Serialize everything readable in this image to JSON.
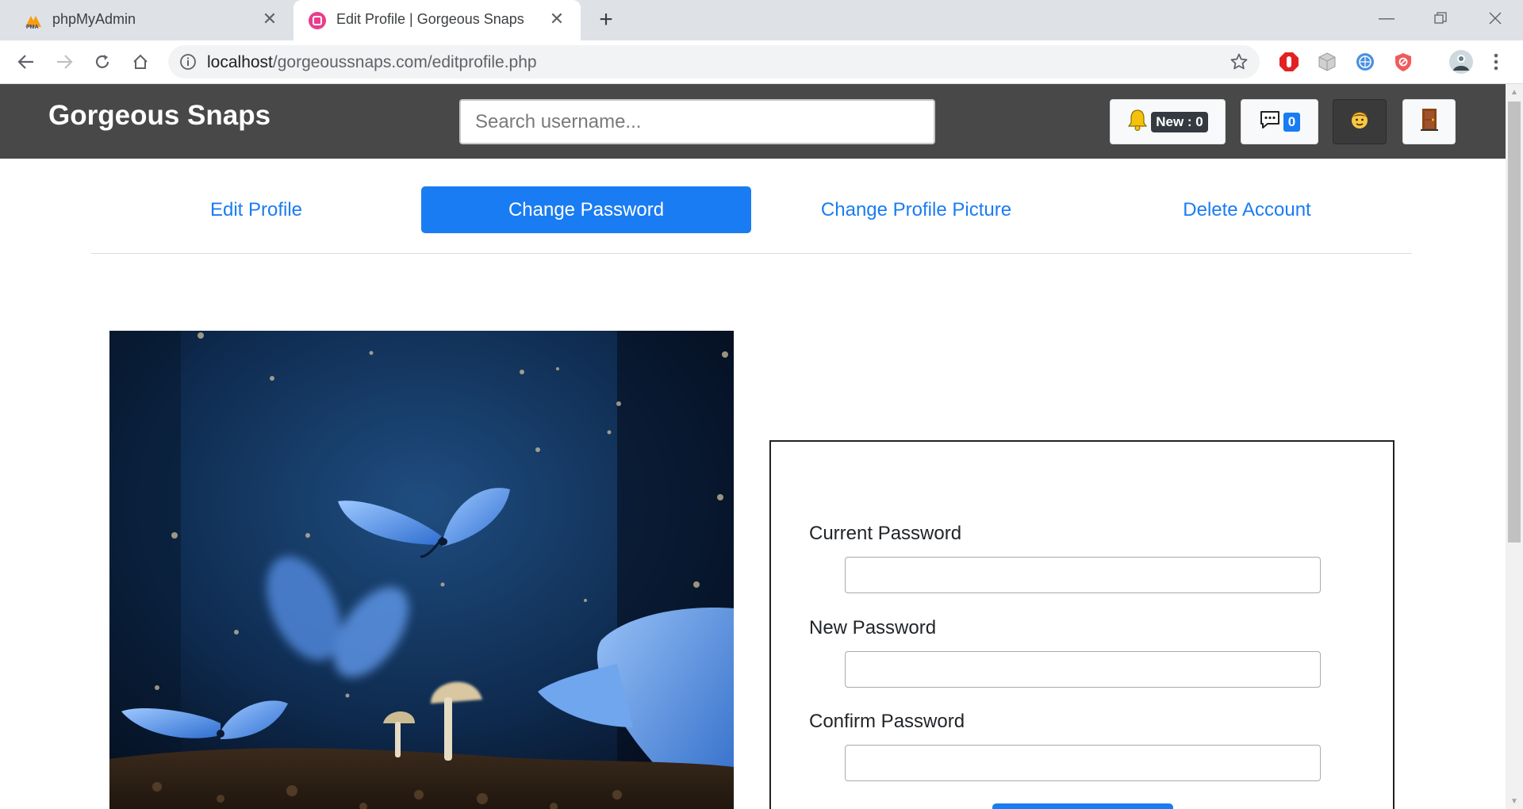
{
  "browser": {
    "tabs": [
      {
        "title": "phpMyAdmin",
        "favicon": "phpmyadmin-logo",
        "active": false
      },
      {
        "title": "Edit Profile | Gorgeous Snaps",
        "favicon": "pink-circle-logo",
        "active": true
      }
    ],
    "url": {
      "host": "localhost",
      "path": "/gorgeoussnaps.com/editprofile.php"
    }
  },
  "site": {
    "brand": "Gorgeous Snaps",
    "search": {
      "placeholder": "Search username...",
      "value": ""
    },
    "notifications": {
      "label": "New : 0",
      "icon": "bell-icon"
    },
    "messages": {
      "count": "0",
      "icon": "chat-icon"
    },
    "profile": {
      "icon": "face-emoji-icon"
    },
    "logout": {
      "icon": "door-icon"
    }
  },
  "tabs": [
    {
      "label": "Edit Profile",
      "active": false
    },
    {
      "label": "Change Password",
      "active": true
    },
    {
      "label": "Change Profile Picture",
      "active": false
    },
    {
      "label": "Delete Account",
      "active": false
    }
  ],
  "form": {
    "current_password_label": "Current Password",
    "new_password_label": "New Password",
    "confirm_password_label": "Confirm Password"
  },
  "colors": {
    "accent": "#1a7cf2",
    "navbar": "#484848"
  }
}
